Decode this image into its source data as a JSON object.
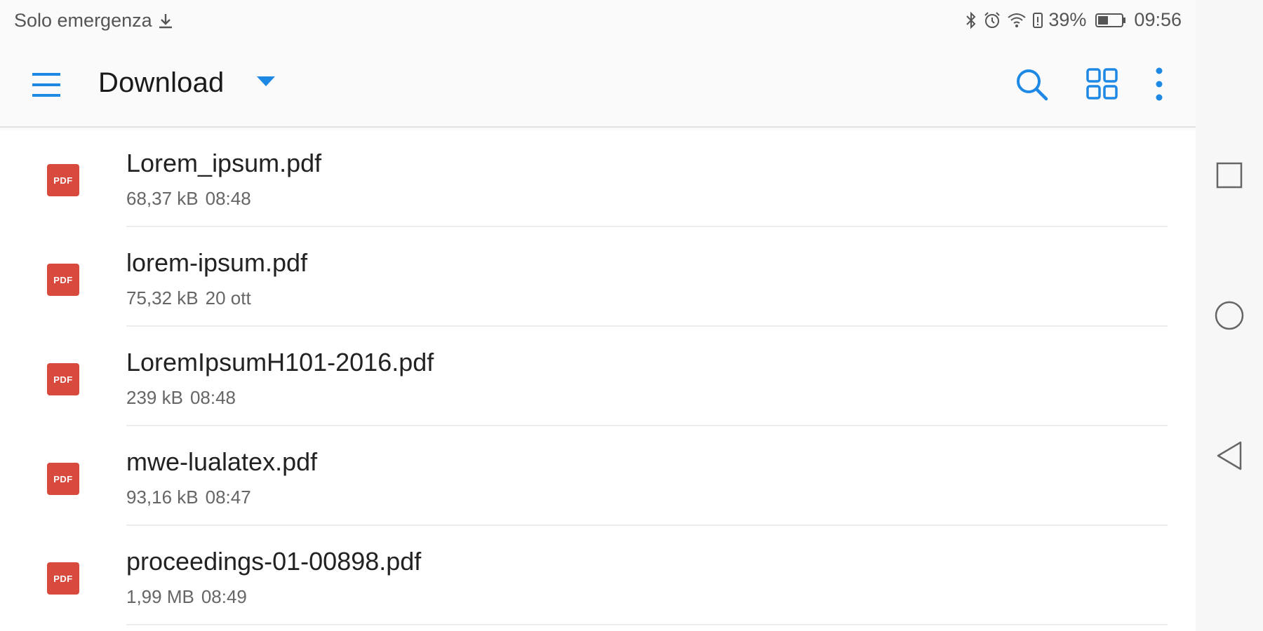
{
  "status_bar": {
    "carrier_text": "Solo emergenza",
    "battery_percent": "39%",
    "time": "09:56",
    "icons": [
      "download-icon",
      "bluetooth-icon",
      "alarm-icon",
      "wifi-icon",
      "battery-saver-icon",
      "battery-icon"
    ]
  },
  "app_bar": {
    "title": "Download",
    "accent_color": "#1e88e5",
    "actions": [
      "search-icon",
      "grid-view-icon",
      "more-vert-icon"
    ]
  },
  "files": [
    {
      "name": "Lorem_ipsum.pdf",
      "size": "68,37 kB",
      "date": "08:48",
      "icon_label": "PDF"
    },
    {
      "name": "lorem-ipsum.pdf",
      "size": "75,32 kB",
      "date": "20 ott",
      "icon_label": "PDF"
    },
    {
      "name": "LoremIpsumH101-2016.pdf",
      "size": "239 kB",
      "date": "08:48",
      "icon_label": "PDF"
    },
    {
      "name": "mwe-lualatex.pdf",
      "size": "93,16 kB",
      "date": "08:47",
      "icon_label": "PDF"
    },
    {
      "name": "proceedings-01-00898.pdf",
      "size": "1,99 MB",
      "date": "08:49",
      "icon_label": "PDF"
    }
  ],
  "nav_bar": {
    "buttons": [
      "recents-square-icon",
      "home-circle-icon",
      "back-triangle-icon"
    ]
  }
}
